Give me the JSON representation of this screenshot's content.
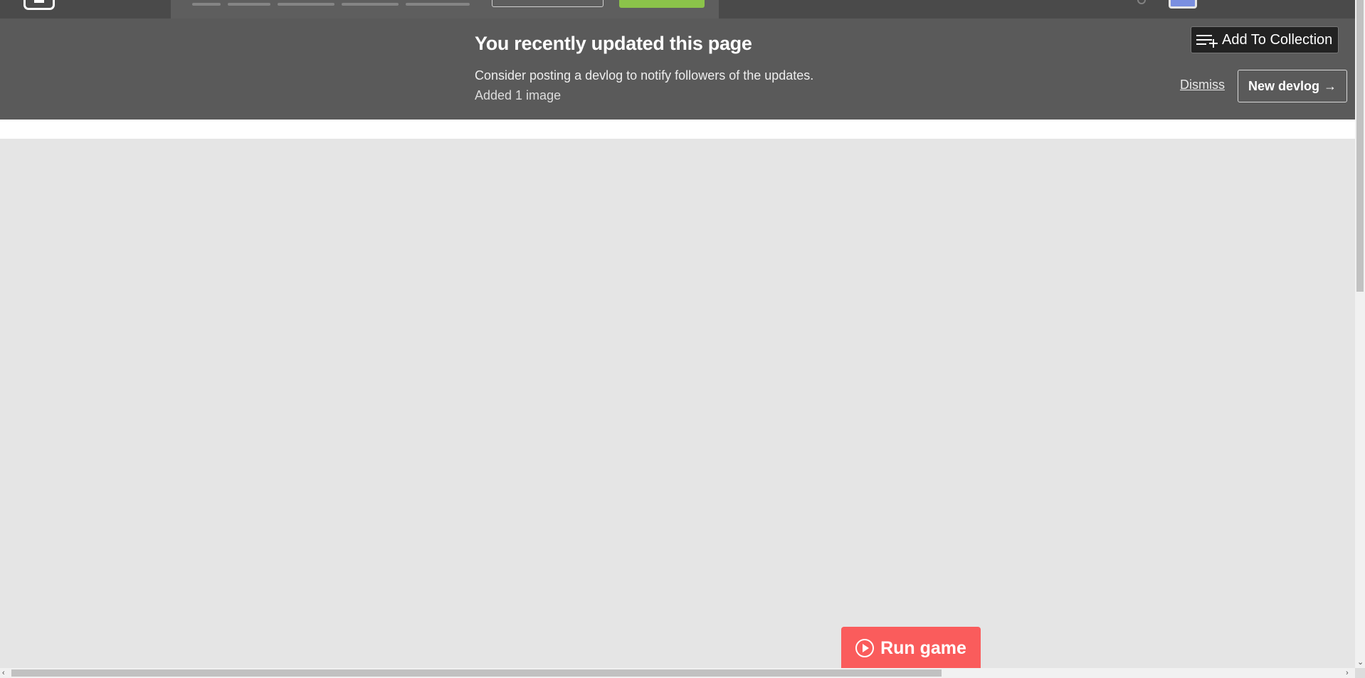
{
  "banner": {
    "title": "You recently updated this page",
    "message": "Consider posting a devlog to notify followers of the updates.",
    "detail": "Added 1 image",
    "add_to_collection_label": "Add To Collection",
    "dismiss_label": "Dismiss",
    "new_devlog_label": "New devlog",
    "new_devlog_arrow": "→"
  },
  "game": {
    "run_label": "Run game"
  },
  "scrollbars": {
    "left_arrow": "‹",
    "right_arrow": "›",
    "down_arrow": "⌄"
  },
  "colors": {
    "banner_bg": "#5a5a5a",
    "run_button": "#fa5c5c",
    "header_green": "#8bc34a"
  }
}
